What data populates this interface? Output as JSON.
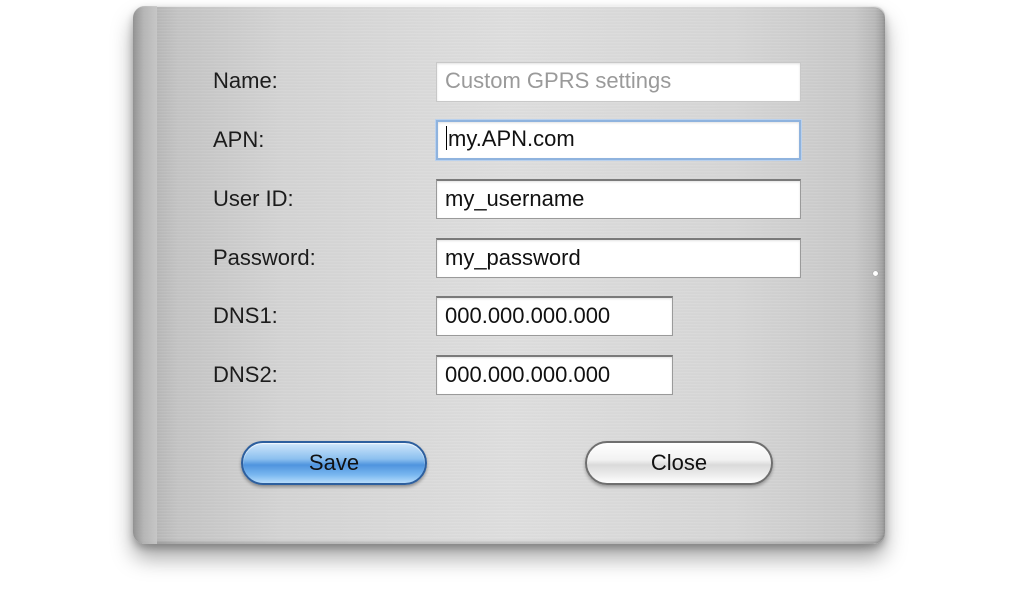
{
  "form": {
    "fields": [
      {
        "label": "Name:",
        "value": "",
        "placeholder": "Custom GPRS settings"
      },
      {
        "label": "APN:",
        "value": "my.APN.com"
      },
      {
        "label": "User ID:",
        "value": "my_username"
      },
      {
        "label": "Password:",
        "value": "my_password"
      },
      {
        "label": "DNS1:",
        "value": "000.000.000.000"
      },
      {
        "label": "DNS2:",
        "value": "000.000.000.000"
      }
    ]
  },
  "buttons": {
    "save_label": "Save",
    "close_label": "Close"
  },
  "colors": {
    "save_button": "#4f94de",
    "focus_ring": "#8fb3de",
    "panel_metal": "#d6d6d6"
  }
}
